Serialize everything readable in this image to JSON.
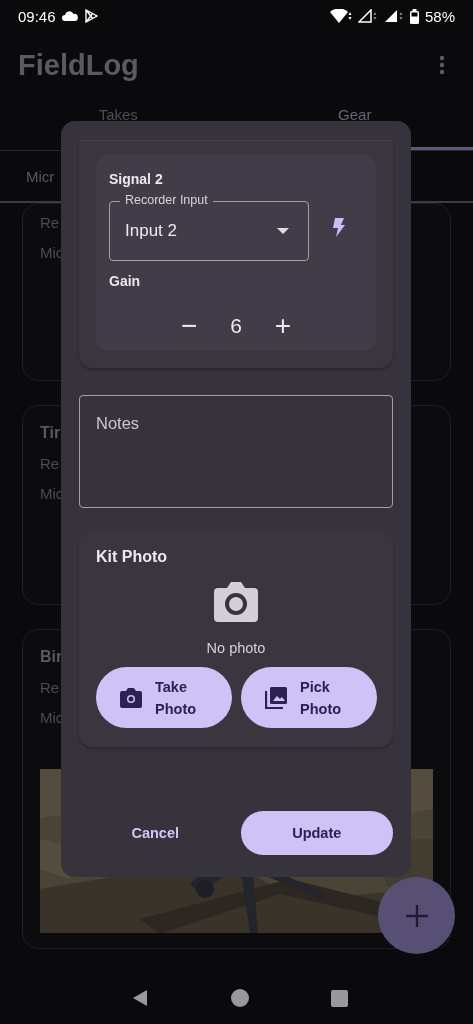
{
  "status_bar": {
    "time": "09:46",
    "battery": "58%"
  },
  "app_bar": {
    "title": "FieldLog"
  },
  "tabs": [
    {
      "label": "Takes",
      "selected": false
    },
    {
      "label": "Gear",
      "selected": true
    }
  ],
  "sub_tab": {
    "label": "Micr"
  },
  "cards": [
    {
      "lines": [
        "Re",
        "Mic"
      ]
    },
    {
      "title": "Tir",
      "lines": [
        "Re",
        "Mic"
      ]
    },
    {
      "title": "Bir",
      "lines": [
        "Re",
        "Mic"
      ],
      "photo": {
        "kind": "picture"
      }
    }
  ],
  "dialog": {
    "signal": {
      "title": "Signal 2",
      "input_label": "Recorder Input",
      "input_value": "Input 2",
      "gain_label": "Gain",
      "decrement": "−",
      "gain_value": "6",
      "increment": "+"
    },
    "notes": {
      "placeholder": "Notes"
    },
    "kit_photo": {
      "title": "Kit Photo",
      "empty_text": "No photo",
      "buttons": [
        {
          "label": "Take Photo",
          "kind": "camera"
        },
        {
          "label": "Pick Photo",
          "kind": "gallery"
        }
      ]
    },
    "actions": [
      {
        "label": "Cancel",
        "kind": "text"
      },
      {
        "label": "Update",
        "kind": "filled"
      }
    ]
  }
}
